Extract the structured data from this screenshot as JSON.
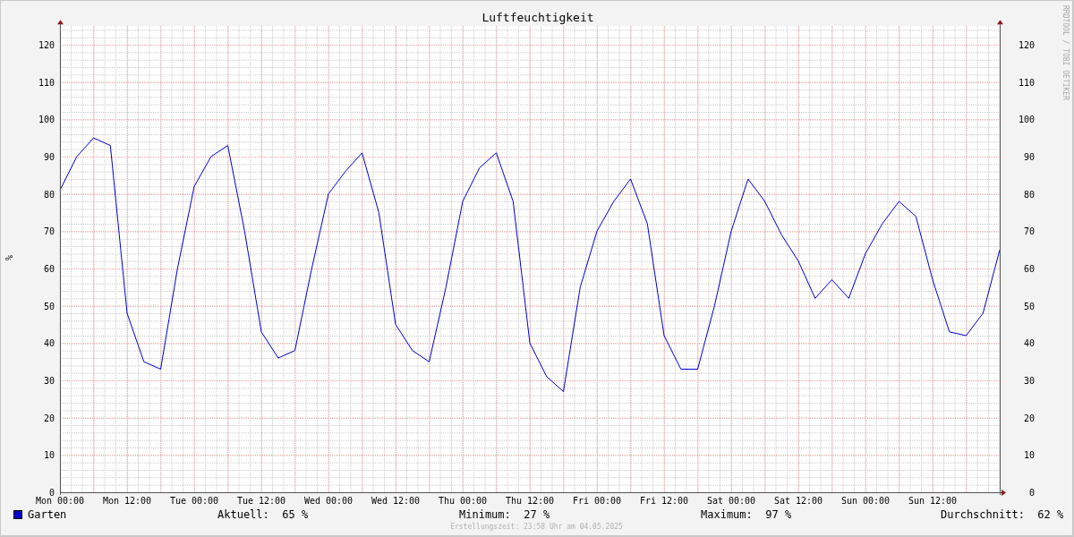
{
  "chart_data": {
    "type": "line",
    "title": "Luftfeuchtigkeit",
    "ylabel": "%",
    "categories": [
      "Mon 00:00",
      null,
      null,
      null,
      "Mon 12:00",
      null,
      null,
      null,
      "Tue 00:00",
      null,
      null,
      null,
      "Tue 12:00",
      null,
      null,
      null,
      "Wed 00:00",
      null,
      null,
      null,
      "Wed 12:00",
      null,
      null,
      null,
      "Thu 00:00",
      null,
      null,
      null,
      "Thu 12:00",
      null,
      null,
      null,
      "Fri 00:00",
      null,
      null,
      null,
      "Fri 12:00",
      null,
      null,
      null,
      "Sat 00:00",
      null,
      null,
      null,
      "Sat 12:00",
      null,
      null,
      null,
      "Sun 00:00",
      null,
      null,
      null,
      "Sun 12:00",
      null,
      null,
      null,
      null
    ],
    "series": [
      {
        "name": "Garten",
        "color": "#0000cc",
        "values": [
          81,
          90,
          95,
          93,
          48,
          35,
          33,
          60,
          82,
          90,
          93,
          70,
          43,
          36,
          38,
          60,
          80,
          86,
          91,
          75,
          45,
          38,
          35,
          55,
          78,
          87,
          91,
          78,
          40,
          31,
          27,
          55,
          70,
          78,
          84,
          72,
          42,
          33,
          33,
          50,
          70,
          84,
          78,
          69,
          62,
          52,
          57,
          52,
          64,
          72,
          78,
          74,
          57,
          43,
          42,
          48,
          65
        ]
      }
    ],
    "ylim": [
      0,
      125
    ],
    "grid": true,
    "yticks": [
      0,
      10,
      20,
      30,
      40,
      50,
      60,
      70,
      80,
      90,
      100,
      110,
      120
    ]
  },
  "right_axis": {
    "ticks": [
      "120",
      "110",
      "100",
      "90",
      "80",
      "70",
      "60",
      "50",
      "40",
      "30",
      "20",
      "10",
      "0"
    ]
  },
  "watermark_text": "RRDTOOL / TOBI OETIKER",
  "legend": {
    "stats": [
      {
        "label": "Aktuell:",
        "value": "65 %"
      },
      {
        "label": "Minimum:",
        "value": "27 %"
      },
      {
        "label": "Maximum:",
        "value": "97 %"
      },
      {
        "label": "Durchschnitt:",
        "value": "62 %"
      }
    ]
  },
  "footer": "Erstellungszeit: 23:58 Uhr am 04.05.2025"
}
